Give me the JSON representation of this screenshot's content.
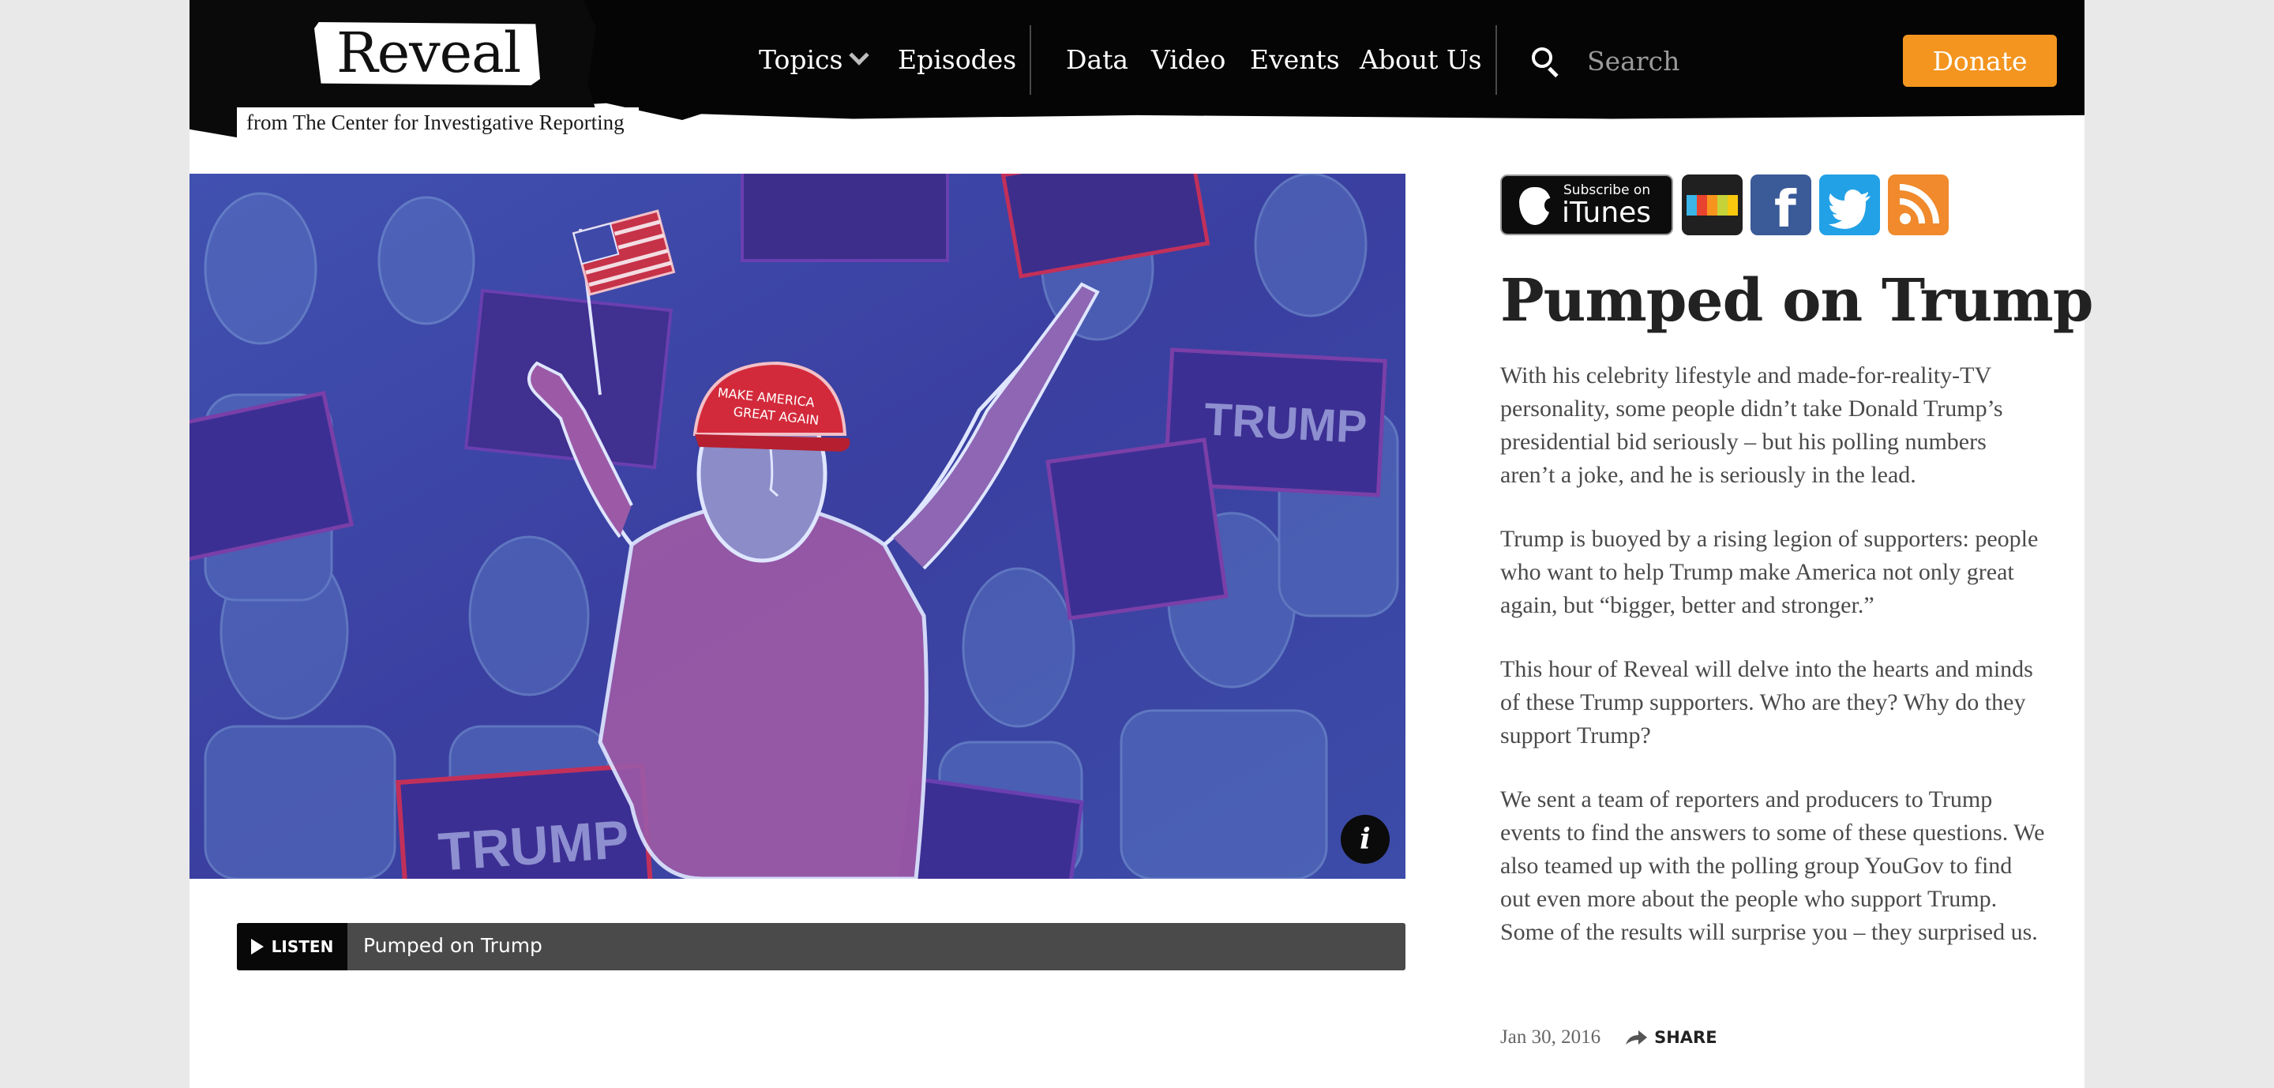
{
  "brand": {
    "logo": "Reveal",
    "subtitle": "from The Center for Investigative Reporting"
  },
  "nav": {
    "topics": "Topics",
    "episodes": "Episodes",
    "data": "Data",
    "video": "Video",
    "events": "Events",
    "about": "About Us"
  },
  "search": {
    "placeholder": "Search"
  },
  "donate": "Donate",
  "hero": {
    "cap_text": "MAKE AMERICA GREAT AGAIN",
    "sign_text": "TRUMP",
    "info_label": "i"
  },
  "player": {
    "listen": "LISTEN",
    "title": "Pumped on Trump"
  },
  "social": {
    "itunes_small": "Subscribe on",
    "itunes_big": "iTunes",
    "facebook": "f"
  },
  "episode": {
    "title": "Pumped on Trump",
    "paragraphs": [
      "With his celebrity lifestyle and made-for-reality-TV personality, some people didn’t take Donald Trump’s presidential bid seriously – but his polling numbers aren’t a joke, and he is seriously in the lead.",
      "Trump is buoyed by a rising legion of supporters: people who want to help Trump make America not only great again, but “bigger, better and stronger.”",
      "This hour of Reveal will delve into the hearts and minds of these Trump supporters. Who are they? Why do they support Trump?",
      "We sent a team of reporters and producers to Trump events to find the answers to some of these questions. We also teamed up with the polling group YouGov to find out even more about the people who support Trump. Some of the results will surprise you – they surprised us."
    ],
    "date": "Jan 30, 2016",
    "share": "SHARE"
  },
  "colors": {
    "donate": "#f3951f",
    "header": "#050505",
    "facebook": "#3a5a98",
    "twitter": "#22a1e6",
    "rss": "#f08a2c"
  }
}
